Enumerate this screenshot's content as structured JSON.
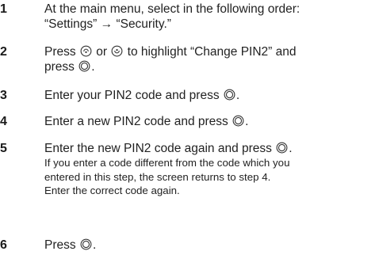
{
  "steps": [
    {
      "num": "1",
      "lines": [
        "At the main menu, select in the following order:",
        "“Settings” → “Security.”"
      ]
    },
    {
      "num": "2",
      "line1_a": "Press",
      "line1_b": "or",
      "line1_c": "to highlight “Change PIN2” and",
      "line2_a": "press",
      "line2_b": "."
    },
    {
      "num": "3",
      "a": "Enter your PIN2 code and press",
      "b": "."
    },
    {
      "num": "4",
      "a": "Enter a new PIN2 code and press",
      "b": "."
    },
    {
      "num": "5",
      "a": "Enter the new PIN2 code again and press",
      "b": ".",
      "note": [
        "If you enter a code different from the code which you",
        "entered in this step, the screen returns to step 4.",
        "Enter the correct code again."
      ]
    },
    {
      "num": "6",
      "a": "Press",
      "b": "."
    }
  ],
  "icons": {
    "scroll_up": "scroll-up-key-icon",
    "scroll_down": "scroll-down-key-icon",
    "center": "center-select-key-icon"
  }
}
